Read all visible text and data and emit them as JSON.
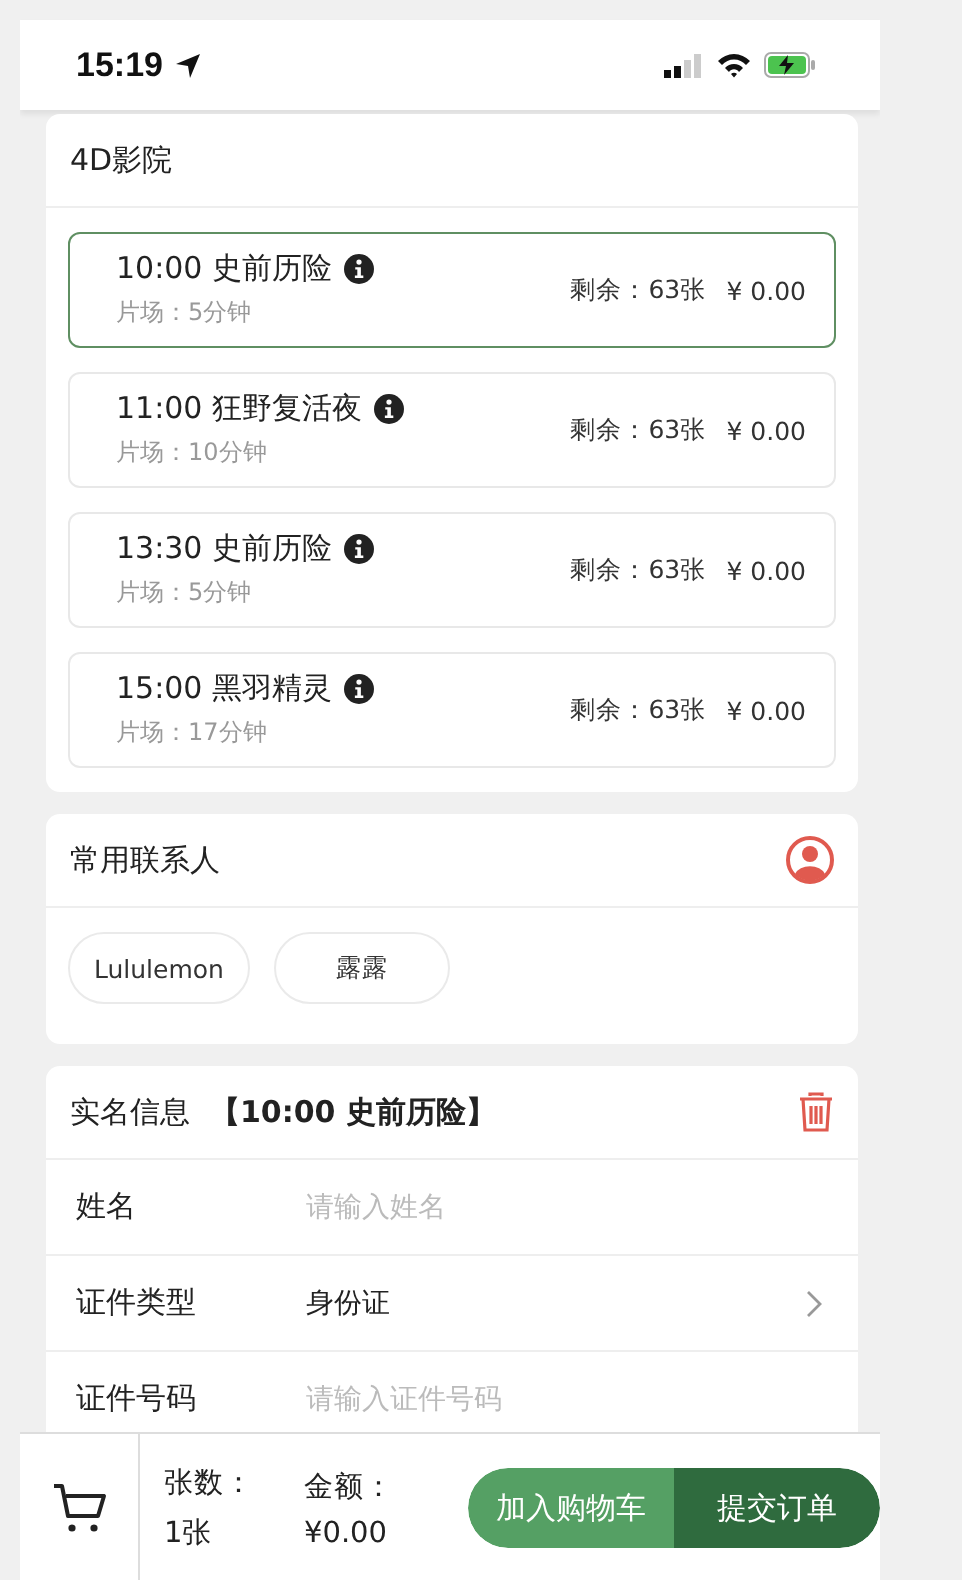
{
  "status_bar": {
    "time": "15:19"
  },
  "cinema": {
    "title": "4D影院",
    "sessions": [
      {
        "title": "10:00 史前历险",
        "duration": "片场：5分钟",
        "remaining": "剩余：63张",
        "price": "¥ 0.00",
        "selected": true
      },
      {
        "title": "11:00 狂野复活夜",
        "duration": "片场：10分钟",
        "remaining": "剩余：63张",
        "price": "¥ 0.00",
        "selected": false
      },
      {
        "title": "13:30 史前历险",
        "duration": "片场：5分钟",
        "remaining": "剩余：63张",
        "price": "¥ 0.00",
        "selected": false
      },
      {
        "title": "15:00 黑羽精灵",
        "duration": "片场：17分钟",
        "remaining": "剩余：63张",
        "price": "¥ 0.00",
        "selected": false
      }
    ]
  },
  "contacts": {
    "title": "常用联系人",
    "items": [
      "Lululemon",
      "露露"
    ]
  },
  "real_name": {
    "title": "实名信息",
    "session": "【10:00 史前历险】",
    "fields": [
      {
        "label": "姓名",
        "kind": "input",
        "placeholder": "请输入姓名"
      },
      {
        "label": "证件类型",
        "kind": "select",
        "value": "身份证"
      },
      {
        "label": "证件号码",
        "kind": "input",
        "placeholder": "请输入证件号码"
      }
    ]
  },
  "bottom_bar": {
    "count_label": "张数：",
    "count": "1张",
    "amount_label": "金额：",
    "amount": "¥0.00",
    "add_to_cart": "加入购物车",
    "submit": "提交订单"
  }
}
